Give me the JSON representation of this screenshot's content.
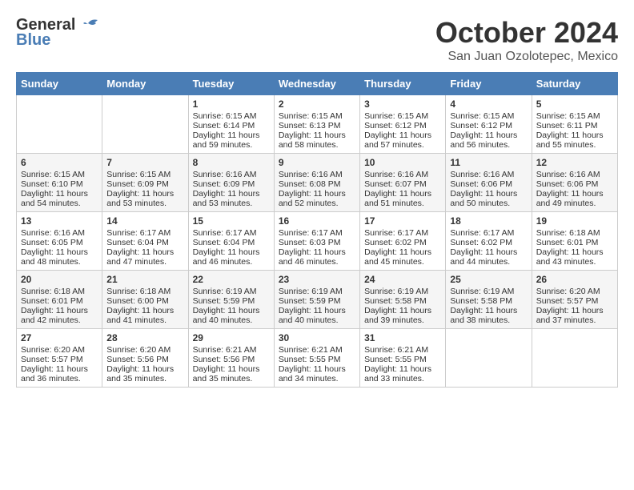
{
  "header": {
    "logo_general": "General",
    "logo_blue": "Blue",
    "month_title": "October 2024",
    "location": "San Juan Ozolotepec, Mexico"
  },
  "days_of_week": [
    "Sunday",
    "Monday",
    "Tuesday",
    "Wednesday",
    "Thursday",
    "Friday",
    "Saturday"
  ],
  "weeks": [
    [
      {
        "day": "",
        "empty": true
      },
      {
        "day": "",
        "empty": true
      },
      {
        "day": "1",
        "sunrise": "Sunrise: 6:15 AM",
        "sunset": "Sunset: 6:14 PM",
        "daylight": "Daylight: 11 hours and 59 minutes."
      },
      {
        "day": "2",
        "sunrise": "Sunrise: 6:15 AM",
        "sunset": "Sunset: 6:13 PM",
        "daylight": "Daylight: 11 hours and 58 minutes."
      },
      {
        "day": "3",
        "sunrise": "Sunrise: 6:15 AM",
        "sunset": "Sunset: 6:12 PM",
        "daylight": "Daylight: 11 hours and 57 minutes."
      },
      {
        "day": "4",
        "sunrise": "Sunrise: 6:15 AM",
        "sunset": "Sunset: 6:12 PM",
        "daylight": "Daylight: 11 hours and 56 minutes."
      },
      {
        "day": "5",
        "sunrise": "Sunrise: 6:15 AM",
        "sunset": "Sunset: 6:11 PM",
        "daylight": "Daylight: 11 hours and 55 minutes."
      }
    ],
    [
      {
        "day": "6",
        "sunrise": "Sunrise: 6:15 AM",
        "sunset": "Sunset: 6:10 PM",
        "daylight": "Daylight: 11 hours and 54 minutes."
      },
      {
        "day": "7",
        "sunrise": "Sunrise: 6:15 AM",
        "sunset": "Sunset: 6:09 PM",
        "daylight": "Daylight: 11 hours and 53 minutes."
      },
      {
        "day": "8",
        "sunrise": "Sunrise: 6:16 AM",
        "sunset": "Sunset: 6:09 PM",
        "daylight": "Daylight: 11 hours and 53 minutes."
      },
      {
        "day": "9",
        "sunrise": "Sunrise: 6:16 AM",
        "sunset": "Sunset: 6:08 PM",
        "daylight": "Daylight: 11 hours and 52 minutes."
      },
      {
        "day": "10",
        "sunrise": "Sunrise: 6:16 AM",
        "sunset": "Sunset: 6:07 PM",
        "daylight": "Daylight: 11 hours and 51 minutes."
      },
      {
        "day": "11",
        "sunrise": "Sunrise: 6:16 AM",
        "sunset": "Sunset: 6:06 PM",
        "daylight": "Daylight: 11 hours and 50 minutes."
      },
      {
        "day": "12",
        "sunrise": "Sunrise: 6:16 AM",
        "sunset": "Sunset: 6:06 PM",
        "daylight": "Daylight: 11 hours and 49 minutes."
      }
    ],
    [
      {
        "day": "13",
        "sunrise": "Sunrise: 6:16 AM",
        "sunset": "Sunset: 6:05 PM",
        "daylight": "Daylight: 11 hours and 48 minutes."
      },
      {
        "day": "14",
        "sunrise": "Sunrise: 6:17 AM",
        "sunset": "Sunset: 6:04 PM",
        "daylight": "Daylight: 11 hours and 47 minutes."
      },
      {
        "day": "15",
        "sunrise": "Sunrise: 6:17 AM",
        "sunset": "Sunset: 6:04 PM",
        "daylight": "Daylight: 11 hours and 46 minutes."
      },
      {
        "day": "16",
        "sunrise": "Sunrise: 6:17 AM",
        "sunset": "Sunset: 6:03 PM",
        "daylight": "Daylight: 11 hours and 46 minutes."
      },
      {
        "day": "17",
        "sunrise": "Sunrise: 6:17 AM",
        "sunset": "Sunset: 6:02 PM",
        "daylight": "Daylight: 11 hours and 45 minutes."
      },
      {
        "day": "18",
        "sunrise": "Sunrise: 6:17 AM",
        "sunset": "Sunset: 6:02 PM",
        "daylight": "Daylight: 11 hours and 44 minutes."
      },
      {
        "day": "19",
        "sunrise": "Sunrise: 6:18 AM",
        "sunset": "Sunset: 6:01 PM",
        "daylight": "Daylight: 11 hours and 43 minutes."
      }
    ],
    [
      {
        "day": "20",
        "sunrise": "Sunrise: 6:18 AM",
        "sunset": "Sunset: 6:01 PM",
        "daylight": "Daylight: 11 hours and 42 minutes."
      },
      {
        "day": "21",
        "sunrise": "Sunrise: 6:18 AM",
        "sunset": "Sunset: 6:00 PM",
        "daylight": "Daylight: 11 hours and 41 minutes."
      },
      {
        "day": "22",
        "sunrise": "Sunrise: 6:19 AM",
        "sunset": "Sunset: 5:59 PM",
        "daylight": "Daylight: 11 hours and 40 minutes."
      },
      {
        "day": "23",
        "sunrise": "Sunrise: 6:19 AM",
        "sunset": "Sunset: 5:59 PM",
        "daylight": "Daylight: 11 hours and 40 minutes."
      },
      {
        "day": "24",
        "sunrise": "Sunrise: 6:19 AM",
        "sunset": "Sunset: 5:58 PM",
        "daylight": "Daylight: 11 hours and 39 minutes."
      },
      {
        "day": "25",
        "sunrise": "Sunrise: 6:19 AM",
        "sunset": "Sunset: 5:58 PM",
        "daylight": "Daylight: 11 hours and 38 minutes."
      },
      {
        "day": "26",
        "sunrise": "Sunrise: 6:20 AM",
        "sunset": "Sunset: 5:57 PM",
        "daylight": "Daylight: 11 hours and 37 minutes."
      }
    ],
    [
      {
        "day": "27",
        "sunrise": "Sunrise: 6:20 AM",
        "sunset": "Sunset: 5:57 PM",
        "daylight": "Daylight: 11 hours and 36 minutes."
      },
      {
        "day": "28",
        "sunrise": "Sunrise: 6:20 AM",
        "sunset": "Sunset: 5:56 PM",
        "daylight": "Daylight: 11 hours and 35 minutes."
      },
      {
        "day": "29",
        "sunrise": "Sunrise: 6:21 AM",
        "sunset": "Sunset: 5:56 PM",
        "daylight": "Daylight: 11 hours and 35 minutes."
      },
      {
        "day": "30",
        "sunrise": "Sunrise: 6:21 AM",
        "sunset": "Sunset: 5:55 PM",
        "daylight": "Daylight: 11 hours and 34 minutes."
      },
      {
        "day": "31",
        "sunrise": "Sunrise: 6:21 AM",
        "sunset": "Sunset: 5:55 PM",
        "daylight": "Daylight: 11 hours and 33 minutes."
      },
      {
        "day": "",
        "empty": true
      },
      {
        "day": "",
        "empty": true
      }
    ]
  ]
}
